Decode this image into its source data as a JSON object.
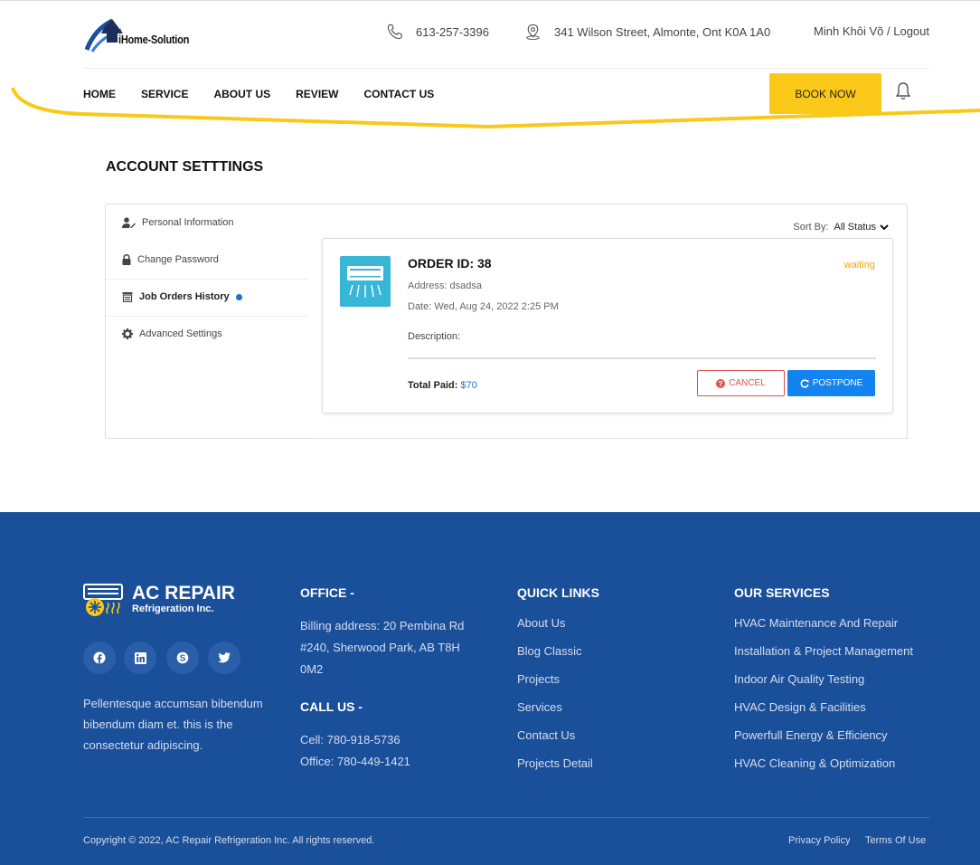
{
  "header": {
    "logo_text": "iHome-Solution",
    "phone": "613-257-3396",
    "address": "341 Wilson Street, Almonte, Ont K0A 1A0",
    "user_name": "Minh Khôi Võ",
    "separator": "/",
    "logout": "Logout",
    "nav": [
      "HOME",
      "SERVICE",
      "ABOUT US",
      "REVIEW",
      "CONTACT US"
    ],
    "book_now": "BOOK NOW",
    "accent_color": "#f9c818"
  },
  "account": {
    "title": "ACCOUNT SETTTINGS",
    "sidebar": [
      {
        "label": "Personal Information",
        "icon": "user-edit-icon"
      },
      {
        "label": "Change Password",
        "icon": "lock-icon"
      },
      {
        "label": "Job Orders History",
        "icon": "history-icon",
        "active": true
      },
      {
        "label": "Advanced Settings",
        "icon": "gear-icon"
      }
    ],
    "sort_label": "Sort By:",
    "sort_value": "All Status"
  },
  "order": {
    "id_label": "ORDER ID: 38",
    "status": "waiting",
    "address": "Address: dsadsa",
    "date": "Date: Wed, Aug 24, 2022 2:25 PM",
    "description": "Description:",
    "total_label": "Total Paid:",
    "total_value": "$70",
    "cancel": "CANCEL",
    "postpone": "POSTPONE",
    "image_icon": "air-conditioner-icon",
    "status_color": "#f0a500"
  },
  "footer": {
    "brand": "AC REPAIR",
    "brand_sub": "Refrigeration Inc.",
    "about": "Pellentesque accumsan bibendum bibendum diam et. this is the consectetur adipiscing.",
    "office_title": "OFFICE -",
    "office_address": "Billing address: 20 Pembina Rd #240, Sherwood Park, AB T8H 0M2",
    "call_title": "CALL US -",
    "cell": "Cell: 780-918-5736",
    "office_phone": "Office: 780-449-1421",
    "quick_links_title": "QUICK LINKS",
    "quick_links": [
      "About Us",
      "Blog Classic",
      "Projects",
      "Services",
      "Contact Us",
      "Projects Detail"
    ],
    "services_title": "OUR SERVICES",
    "services": [
      "HVAC Maintenance And Repair",
      "Installation & Project Management",
      "Indoor Air Quality Testing",
      "HVAC Design & Facilities",
      "Powerfull Energy & Efficiency",
      "HVAC Cleaning & Optimization"
    ],
    "copyright": "Copyright © 2022, AC Repair Refrigeration Inc. All rights reserved.",
    "privacy": "Privacy Policy",
    "terms": "Terms Of Use",
    "background_color": "#1a4f9a",
    "social": [
      "facebook-icon",
      "linkedin-icon",
      "skype-icon",
      "twitter-icon"
    ]
  }
}
